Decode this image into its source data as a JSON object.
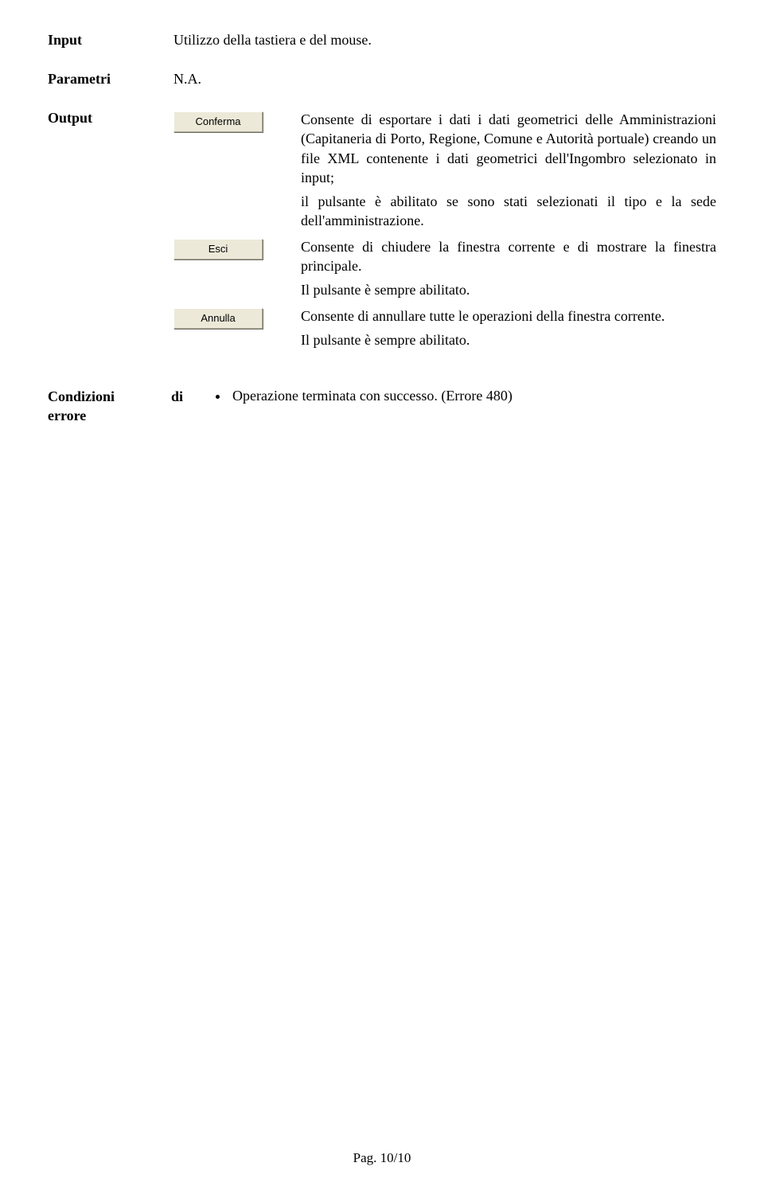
{
  "input": {
    "label": "Input",
    "value": "Utilizzo della tastiera e del mouse."
  },
  "parametri": {
    "label": "Parametri",
    "value": "N.A."
  },
  "output": {
    "label": "Output",
    "items": [
      {
        "button": "Conferma",
        "paragraphs": [
          "Consente di esportare i dati i dati geometrici delle Amministrazioni (Capitaneria di Porto, Regione, Comune e Autorità portuale) creando un file XML contenente i dati geometrici dell'Ingombro selezionato in input;",
          "il pulsante è abilitato se sono stati selezionati il tipo e la sede dell'amministrazione."
        ]
      },
      {
        "button": "Esci",
        "paragraphs": [
          "Consente di chiudere la finestra corrente e di mostrare la finestra principale.",
          "Il pulsante è sempre abilitato."
        ]
      },
      {
        "button": "Annulla",
        "paragraphs": [
          "Consente di annullare tutte le operazioni della finestra corrente.",
          "Il pulsante è sempre abilitato."
        ]
      }
    ]
  },
  "condizioni": {
    "label_line1": "Condizioni",
    "label_di": "di",
    "label_line2": "errore",
    "bullet": "Operazione terminata con successo. (Errore 480)"
  },
  "footer": "Pag. 10/10"
}
